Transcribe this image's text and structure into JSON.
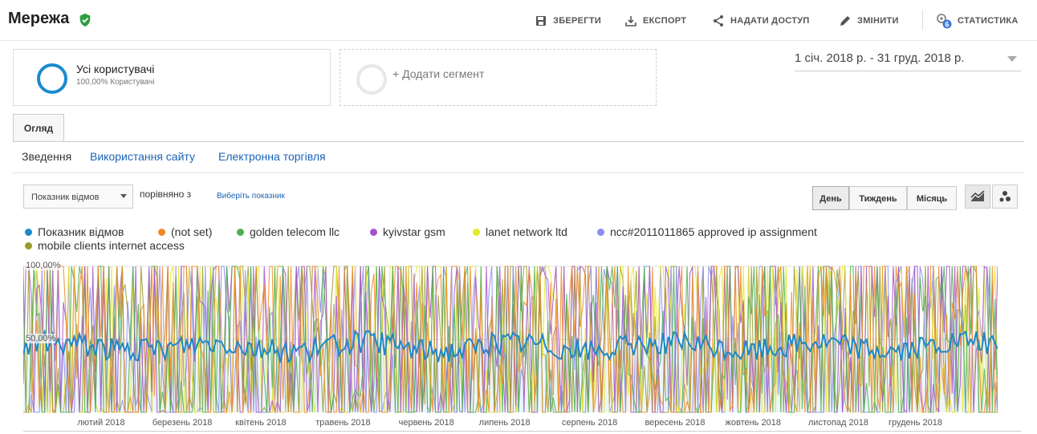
{
  "header": {
    "title": "Мережа",
    "actions": [
      {
        "label": "ЗБЕРЕГТИ",
        "icon": "save-icon"
      },
      {
        "label": "ЕКСПОРТ",
        "icon": "export-icon"
      },
      {
        "label": "НАДАТИ ДОСТУП",
        "icon": "share-icon"
      },
      {
        "label": "ЗМІНИТИ",
        "icon": "pencil-icon"
      },
      {
        "label": "СТАТИСТИКА",
        "icon": "insights-icon",
        "badge": "6"
      }
    ]
  },
  "segments": {
    "active": {
      "name": "Усі користувачі",
      "sub": "100,00% Користувачі"
    },
    "add_label": "+ Додати сегмент"
  },
  "date_range": "1 січ. 2018 р. - 31 груд. 2018 р.",
  "tabs": [
    {
      "label": "Огляд"
    }
  ],
  "subnav": [
    {
      "label": "Зведення",
      "active": true
    },
    {
      "label": "Використання сайту",
      "active": false
    },
    {
      "label": "Електронна торгівля",
      "active": false
    }
  ],
  "controls": {
    "metric": "Показник відмов",
    "compare_label": "порівняно з",
    "choose_metric": "Виберіть показник",
    "granularity": [
      "День",
      "Тиждень",
      "Місяць"
    ],
    "granularity_selected": "День"
  },
  "colors": {
    "accent": "#1a8ad0",
    "link": "#1a64b7",
    "shield": "#2e9e41"
  },
  "chart_data": {
    "type": "line",
    "series": [
      {
        "name": "Показник відмов",
        "color": "#1e88c8"
      },
      {
        "name": "(not set)",
        "color": "#f08a24"
      },
      {
        "name": "golden telecom llc",
        "color": "#4caf50"
      },
      {
        "name": "kyivstar gsm",
        "color": "#a553c9"
      },
      {
        "name": "lanet network ltd",
        "color": "#e6e62a"
      },
      {
        "name": "ncc#2011011865 approved ip assignment",
        "color": "#8c8cf0"
      },
      {
        "name": "mobile clients internet access",
        "color": "#9a9a2a"
      }
    ],
    "y_ticks": [
      "100,00%",
      "50,00%"
    ],
    "ylim": [
      0,
      100
    ],
    "x_ticks": [
      "лютий 2018",
      "березень 2018",
      "квітень 2018",
      "травень 2018",
      "червень 2018",
      "липень 2018",
      "серпень 2018",
      "вересень 2018",
      "жовтень 2018",
      "листопад 2018",
      "грудень 2018"
    ],
    "x_range": [
      "2018-01-01",
      "2018-12-31"
    ],
    "main_series_level": 45,
    "grid": true
  }
}
